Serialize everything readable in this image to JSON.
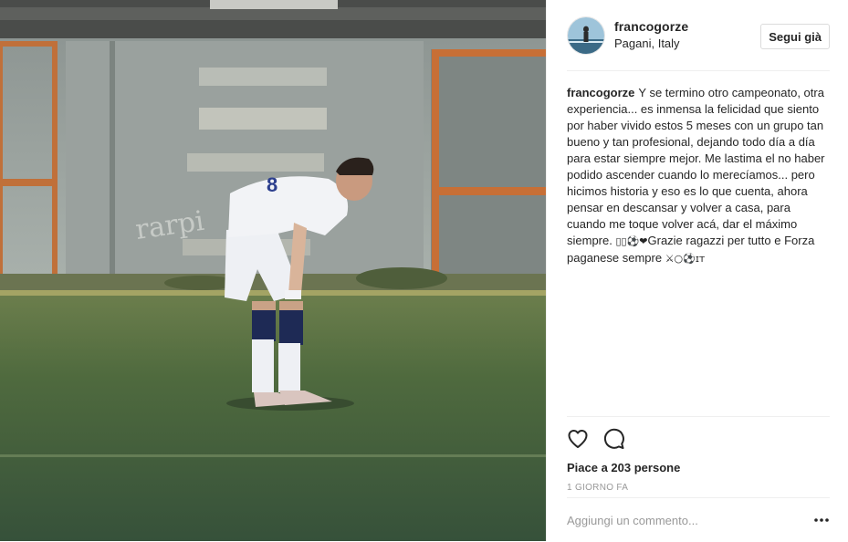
{
  "header": {
    "username": "francogorze",
    "location": "Pagani, Italy",
    "follow_label": "Segui già"
  },
  "caption": {
    "username": "francogorze",
    "text": "Y se termino otro campeonato, otra experiencia... es inmensa la felicidad que siento por haber vivido estos 5 meses con un grupo tan bueno y tan profesional, dejando todo día a día para estar siempre mejor. Me lastima el no haber podido ascender cuando lo merecíamos... pero hicimos historia y eso es lo que cuenta, ahora pensar en descansar y volver a casa, para cuando me toque volver acá, dar el máximo siempre. ",
    "emoji_1": "▯▯⚽❤",
    "text_2": "Grazie ragazzi per tutto e Forza paganese sempre ",
    "emoji_2": "⚔○⚽ɪᴛ"
  },
  "actions": {
    "like_icon": "heart-icon",
    "comment_icon": "comment-icon",
    "likes": "Piace a 203 persone",
    "time_ago": "1 GIORNO FA"
  },
  "comment": {
    "placeholder": "Aggiungi un commento...",
    "more_icon": "ellipsis-icon"
  },
  "colors": {
    "text": "#262626",
    "muted": "#999999",
    "border": "#efefef"
  }
}
